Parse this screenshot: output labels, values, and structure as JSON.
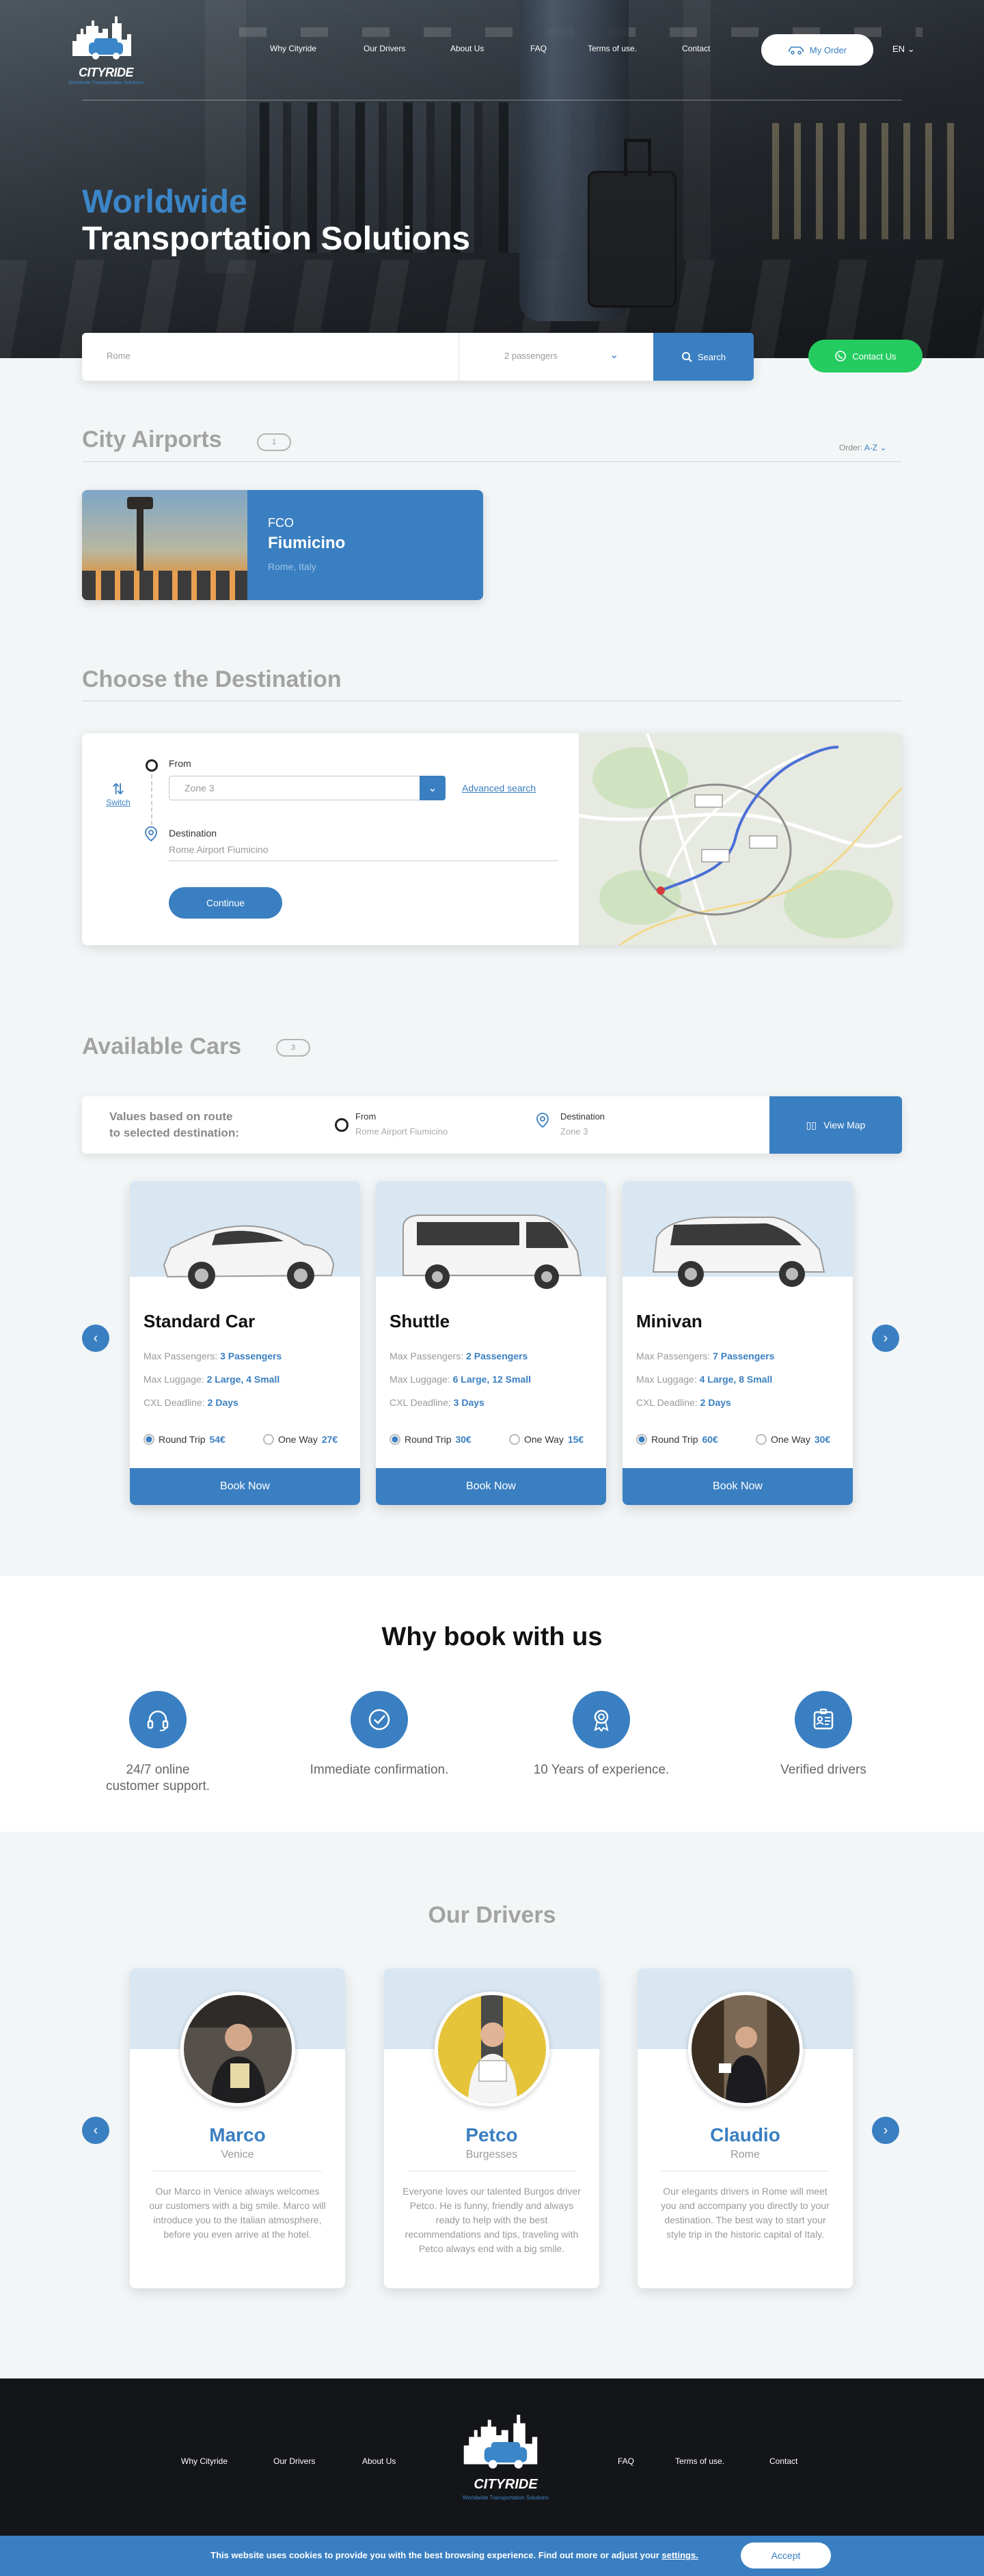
{
  "brand": {
    "name": "CITYRIDE",
    "tagline": "Worldwide Transportation Solutions"
  },
  "nav": [
    "Why Cityride",
    "Our Drivers",
    "About Us",
    "FAQ",
    "Terms of use.",
    "Contact"
  ],
  "header": {
    "my_order": "My Order",
    "language": "EN"
  },
  "hero": {
    "title_line1": "Worldwide",
    "title_line2": "Transportation Solutions"
  },
  "search": {
    "city": "Rome",
    "passengers": "2 passengers",
    "button": "Search"
  },
  "contact_button": "Contact Us",
  "airports": {
    "title": "City Airports",
    "count": "1",
    "order_label": "Order:",
    "order_value": "A-Z",
    "items": [
      {
        "code": "FCO",
        "name": "Fiumicino",
        "location": "Rome, Italy"
      }
    ]
  },
  "destination": {
    "title": "Choose the Destination",
    "switch_label": "Switch",
    "from_label": "From",
    "from_value": "Zone 3",
    "advanced": "Advanced search",
    "dest_label": "Destination",
    "dest_value": "Rome Airport Fiumicino",
    "continue": "Continue"
  },
  "cars": {
    "title": "Available Cars",
    "count": "3",
    "route_text_line1": "Values based on route",
    "route_text_line2": "to selected destination:",
    "from_label": "From",
    "from_value": "Rome Airport Fiumicino",
    "dest_label": "Destination",
    "dest_value": "Zone 3",
    "view_map": "View Map",
    "labels": {
      "passengers": "Max Passengers:",
      "luggage": "Max Luggage:",
      "deadline": "CXL Deadline:",
      "round": "Round Trip",
      "oneway": "One Way",
      "book": "Book Now"
    },
    "items": [
      {
        "name": "Standard Car",
        "passengers": "3 Passengers",
        "luggage": "2 Large, 4 Small",
        "deadline": "2 Days",
        "round_price": "54€",
        "oneway_price": "27€"
      },
      {
        "name": "Shuttle",
        "passengers": "2 Passengers",
        "luggage": "6 Large, 12 Small",
        "deadline": "3 Days",
        "round_price": "30€",
        "oneway_price": "15€"
      },
      {
        "name": "Minivan",
        "passengers": "7 Passengers",
        "luggage": "4 Large, 8 Small",
        "deadline": "2 Days",
        "round_price": "60€",
        "oneway_price": "30€"
      }
    ]
  },
  "why": {
    "title": "Why book with us",
    "features": [
      {
        "icon": "headset-icon",
        "line1": "24/7 online",
        "line2": "customer support."
      },
      {
        "icon": "check-circle-icon",
        "line1": "Immediate confirmation.",
        "line2": ""
      },
      {
        "icon": "award-icon",
        "line1": "10 Years of experience.",
        "line2": ""
      },
      {
        "icon": "id-card-icon",
        "line1": "Verified drivers",
        "line2": ""
      }
    ]
  },
  "drivers": {
    "title": "Our Drivers",
    "items": [
      {
        "name": "Marco",
        "city": "Venice",
        "desc": "Our Marco in Venice always welcomes our customers with a big smile. Marco will introduce you to the Italian atmosphere, before you even arrive at the hotel."
      },
      {
        "name": "Petco",
        "city": "Burgesses",
        "desc": "Everyone loves our talented Burgos driver Petco. He is funny, friendly and always ready to help with the best recommendations and tips, traveling with Petco always end with a big smile."
      },
      {
        "name": "Claudio",
        "city": "Rome",
        "desc": "Our elegants drivers in Rome will meet you and accompany you directly to your destination. The best way to start your style trip in the historic capital of Italy."
      }
    ]
  },
  "cookie": {
    "text": "This website uses cookies to provide you with the best browsing experience. Find out more or adjust your",
    "link": "settings.",
    "accept": "Accept"
  },
  "colors": {
    "accent": "#3a7fc1",
    "whatsapp": "#24cc60",
    "footer": "#141518"
  }
}
